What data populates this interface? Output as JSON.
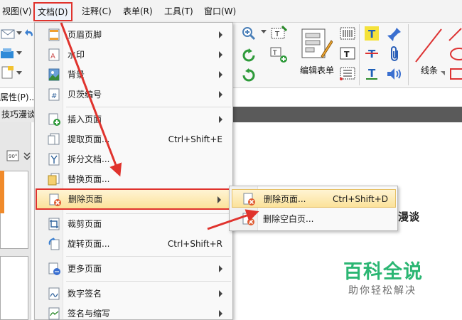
{
  "menubar": {
    "items": [
      {
        "label": "视图(V)"
      },
      {
        "label": "文档(D)"
      },
      {
        "label": "注释(C)"
      },
      {
        "label": "表单(R)"
      },
      {
        "label": "工具(T)"
      },
      {
        "label": "窗口(W)"
      }
    ]
  },
  "ribbon": {
    "properties_label": "属性(P)...",
    "edit_form_label": "编辑表单",
    "lines_label": "线条"
  },
  "tab": {
    "title": "技巧漫谈"
  },
  "document_menu": {
    "items": [
      {
        "label": "页眉页脚",
        "shortcut": ""
      },
      {
        "label": "水印",
        "shortcut": ""
      },
      {
        "label": "背景",
        "shortcut": ""
      },
      {
        "label": "贝茨编号",
        "shortcut": ""
      },
      {
        "label": "插入页面",
        "shortcut": ""
      },
      {
        "label": "提取页面...",
        "shortcut": "Ctrl+Shift+E"
      },
      {
        "label": "拆分文档...",
        "shortcut": ""
      },
      {
        "label": "替换页面...",
        "shortcut": ""
      },
      {
        "label": "删除页面",
        "shortcut": ""
      },
      {
        "label": "裁剪页面",
        "shortcut": ""
      },
      {
        "label": "旋转页面...",
        "shortcut": "Ctrl+Shift+R"
      },
      {
        "label": "更多页面",
        "shortcut": ""
      },
      {
        "label": "数字签名",
        "shortcut": ""
      },
      {
        "label": "签名与缩写",
        "shortcut": ""
      }
    ]
  },
  "delete_submenu": {
    "items": [
      {
        "label": "删除页面...",
        "shortcut": "Ctrl+Shift+D"
      },
      {
        "label": "删除空白页..."
      }
    ]
  },
  "document": {
    "heading_fragment": "漫谈"
  },
  "watermark": {
    "title": "百科全说",
    "subtitle": "助你轻松解决"
  },
  "colors": {
    "highlight_red": "#e0332d",
    "menu_highlight": "#fbe29a",
    "watermark_green": "#2bb673"
  }
}
